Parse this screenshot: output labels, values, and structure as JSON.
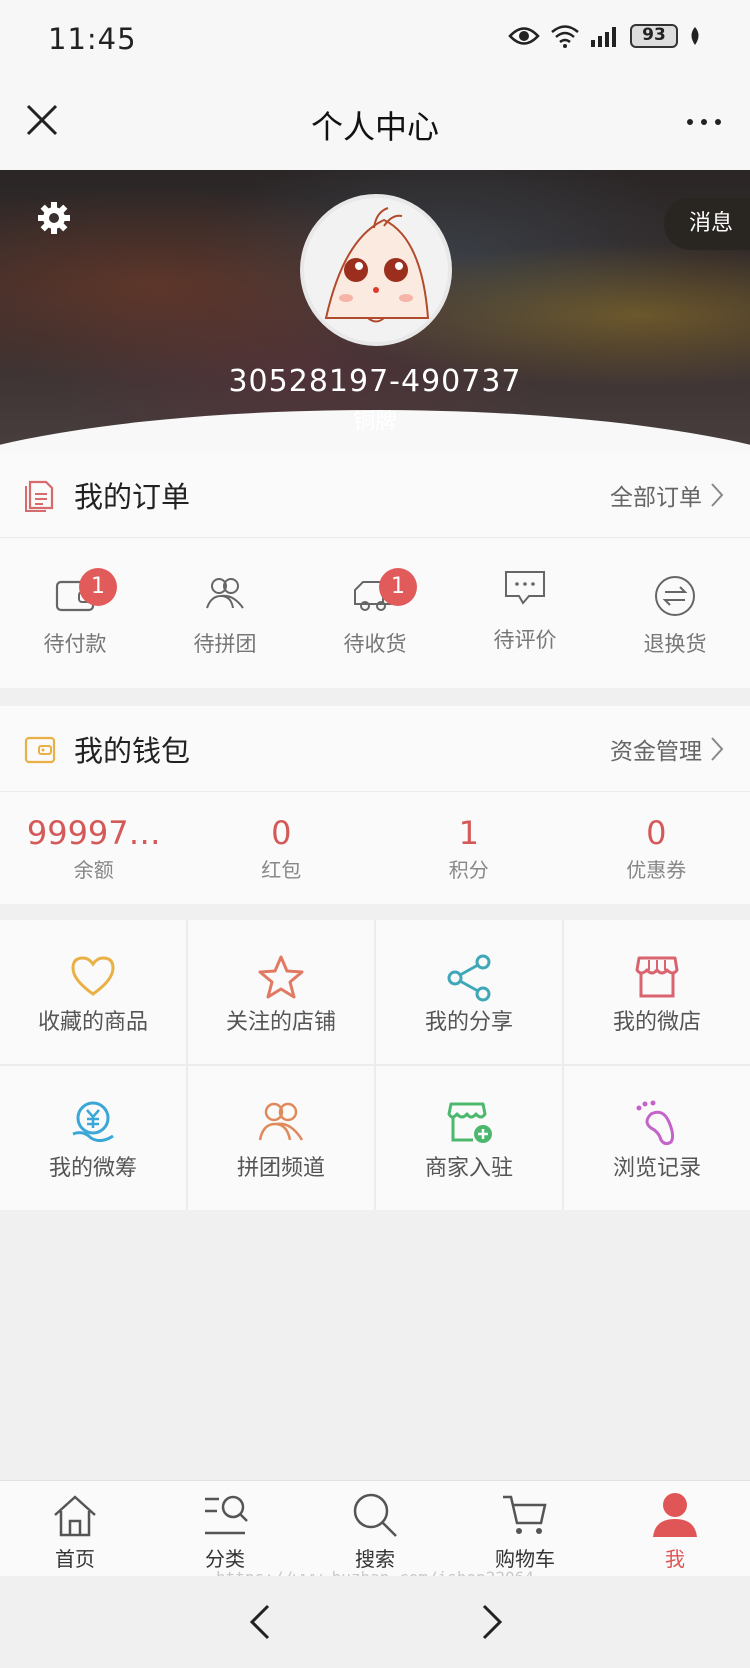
{
  "status_bar": {
    "time": "11:45",
    "battery": "93"
  },
  "nav": {
    "title": "个人中心"
  },
  "profile": {
    "message_label": "消息",
    "username": "30528197-490737",
    "level": "铜牌"
  },
  "orders": {
    "title": "我的订单",
    "link": "全部订单",
    "items": [
      {
        "label": "待付款",
        "icon": "wallet-icon",
        "badge": "1"
      },
      {
        "label": "待拼团",
        "icon": "group-icon",
        "badge": ""
      },
      {
        "label": "待收货",
        "icon": "truck-icon",
        "badge": "1"
      },
      {
        "label": "待评价",
        "icon": "comment-icon",
        "badge": ""
      },
      {
        "label": "退换货",
        "icon": "exchange-icon",
        "badge": ""
      }
    ]
  },
  "wallet": {
    "title": "我的钱包",
    "link": "资金管理",
    "items": [
      {
        "value": "99997…",
        "label": "余额"
      },
      {
        "value": "0",
        "label": "红包"
      },
      {
        "value": "1",
        "label": "积分"
      },
      {
        "value": "0",
        "label": "优惠券"
      }
    ]
  },
  "grid": [
    {
      "label": "收藏的商品",
      "icon": "heart-icon",
      "color": "#e9b145"
    },
    {
      "label": "关注的店铺",
      "icon": "star-icon",
      "color": "#e27a63"
    },
    {
      "label": "我的分享",
      "icon": "share-icon",
      "color": "#3fa8b8"
    },
    {
      "label": "我的微店",
      "icon": "shop-icon",
      "color": "#d9646f"
    },
    {
      "label": "我的微筹",
      "icon": "yuan-hand-icon",
      "color": "#3aa7d6"
    },
    {
      "label": "拼团频道",
      "icon": "group-icon",
      "color": "#e08a5b"
    },
    {
      "label": "商家入驻",
      "icon": "store-add-icon",
      "color": "#4cb86e"
    },
    {
      "label": "浏览记录",
      "icon": "footprint-icon",
      "color": "#c463c9"
    }
  ],
  "tabbar": [
    {
      "label": "首页",
      "icon": "home-icon"
    },
    {
      "label": "分类",
      "icon": "category-icon"
    },
    {
      "label": "搜索",
      "icon": "search-icon"
    },
    {
      "label": "购物车",
      "icon": "cart-icon"
    },
    {
      "label": "我",
      "icon": "user-icon"
    }
  ],
  "watermark": "https://www.huzhan.com/ishop22064",
  "colors": {
    "accent": "#e05555",
    "badge": "#e25b5b",
    "wallet_value": "#d45a5a"
  }
}
